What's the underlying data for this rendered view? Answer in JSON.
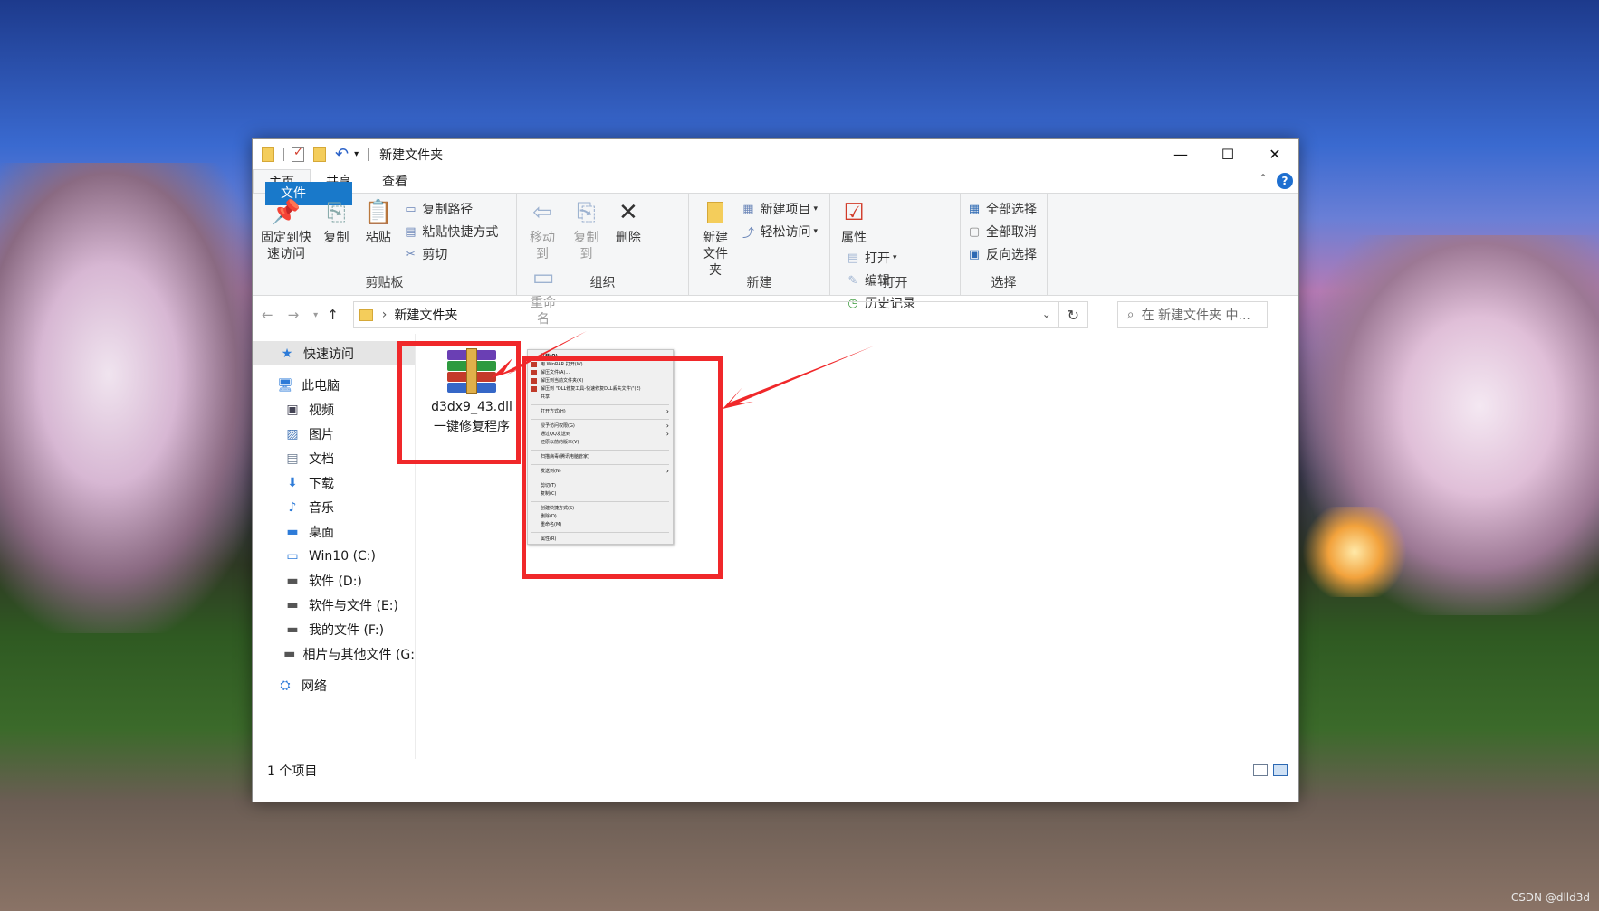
{
  "window": {
    "title": "新建文件夹",
    "controls": {
      "minimize": "—",
      "maximize": "☐",
      "close": "✕"
    }
  },
  "ribbon_tabs": [
    {
      "label": "文件"
    },
    {
      "label": "主页"
    },
    {
      "label": "共享"
    },
    {
      "label": "查看"
    }
  ],
  "ribbon": {
    "clipboard": {
      "label": "剪贴板",
      "pin": "固定到快速访问",
      "copy": "复制",
      "paste": "粘贴",
      "copy_path": "复制路径",
      "paste_shortcut": "粘贴快捷方式",
      "cut": "剪切"
    },
    "organize": {
      "label": "组织",
      "move_to": "移动到",
      "copy_to": "复制到",
      "delete": "删除",
      "rename": "重命名"
    },
    "new": {
      "label": "新建",
      "new_folder": "新建文件夹",
      "new_item": "新建项目",
      "easy_access": "轻松访问"
    },
    "open": {
      "label": "打开",
      "properties": "属性",
      "open": "打开",
      "edit": "编辑",
      "history": "历史记录"
    },
    "select": {
      "label": "选择",
      "select_all": "全部选择",
      "select_none": "全部取消",
      "invert": "反向选择"
    }
  },
  "address": {
    "path": "新建文件夹",
    "search_placeholder": "在 新建文件夹 中..."
  },
  "sidebar": [
    {
      "label": "快速访问",
      "icon": "star-icon"
    },
    {
      "label": "此电脑",
      "icon": "computer-icon"
    },
    {
      "label": "视频",
      "icon": "video-icon"
    },
    {
      "label": "图片",
      "icon": "picture-icon"
    },
    {
      "label": "文档",
      "icon": "document-icon"
    },
    {
      "label": "下载",
      "icon": "download-icon"
    },
    {
      "label": "音乐",
      "icon": "music-icon"
    },
    {
      "label": "桌面",
      "icon": "desktop-icon"
    },
    {
      "label": "Win10 (C:)",
      "icon": "drive-icon"
    },
    {
      "label": "软件 (D:)",
      "icon": "drive-icon"
    },
    {
      "label": "软件与文件 (E:)",
      "icon": "drive-icon"
    },
    {
      "label": "我的文件 (F:)",
      "icon": "drive-icon"
    },
    {
      "label": "相片与其他文件 (G:",
      "icon": "drive-icon"
    },
    {
      "label": "网络",
      "icon": "network-icon"
    }
  ],
  "file": {
    "name": "d3dx9_43.dll一键修复程序",
    "icon": "winrar-archive-icon"
  },
  "context_menu": [
    "打开(O)",
    "用 WinRAR 打开(W)",
    "解压文件(A)...",
    "解压到当前文件夹(X)",
    "解压到 \"DLL修复工具-快速修复DLL丢失文件\\\"(E)",
    "共享",
    "打开方式(H)",
    "授予访问权限(G)",
    "通过QQ发送到",
    "还原以前的版本(V)",
    "扫描病毒(腾讯电脑管家)",
    "发送到(N)",
    "剪切(T)",
    "复制(C)",
    "创建快捷方式(S)",
    "删除(D)",
    "重命名(M)",
    "属性(R)"
  ],
  "status": {
    "count": "1 个项目"
  },
  "watermark": "CSDN @dlld3d",
  "colors": {
    "accent": "#1979ca",
    "highlight": "#f0282a"
  }
}
